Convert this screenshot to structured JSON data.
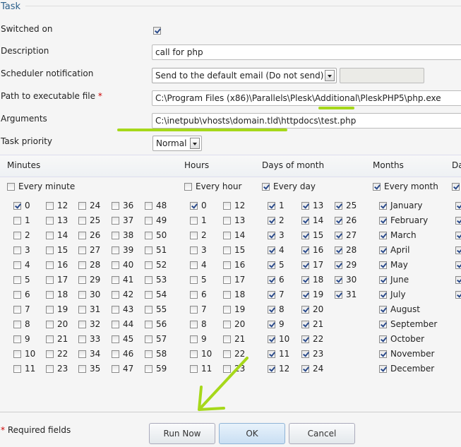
{
  "section_title": "Task",
  "form": {
    "switched_on": {
      "label": "Switched on",
      "checked": true
    },
    "description": {
      "label": "Description",
      "value": "call for php"
    },
    "notification": {
      "label": "Scheduler notification",
      "value": "Send to the default email (Do not send)",
      "email_value": ""
    },
    "path": {
      "label": "Path to executable file",
      "required_mark": "*",
      "value": "C:\\Program Files (x86)\\Parallels\\Plesk\\Additional\\PleskPHP5\\php.exe"
    },
    "arguments": {
      "label": "Arguments",
      "value": "C:\\inetpub\\vhosts\\domain.tld\\httpdocs\\test.php"
    },
    "priority": {
      "label": "Task priority",
      "value": "Normal"
    }
  },
  "schedule": {
    "minutes": {
      "header": "Minutes",
      "every_label": "Every minute",
      "every_checked": false,
      "checked": [
        0
      ]
    },
    "hours": {
      "header": "Hours",
      "every_label": "Every hour",
      "every_checked": false,
      "checked": [
        0
      ]
    },
    "days": {
      "header": "Days of month",
      "every_label": "Every day",
      "every_checked": true
    },
    "months": {
      "header": "Months",
      "every_label": "Every month",
      "every_checked": true,
      "items": [
        "January",
        "February",
        "March",
        "April",
        "May",
        "June",
        "July",
        "August",
        "September",
        "October",
        "November",
        "December"
      ]
    },
    "weekdays": {
      "header": "Da",
      "every_checked": true
    }
  },
  "footer": {
    "required_mark": "*",
    "required_text": "Required fields",
    "run_now": "Run Now",
    "ok": "OK",
    "cancel": "Cancel"
  },
  "colors": {
    "annotation": "#a6d81a",
    "legend": "#2b5f8a",
    "required": "#cc0000"
  }
}
